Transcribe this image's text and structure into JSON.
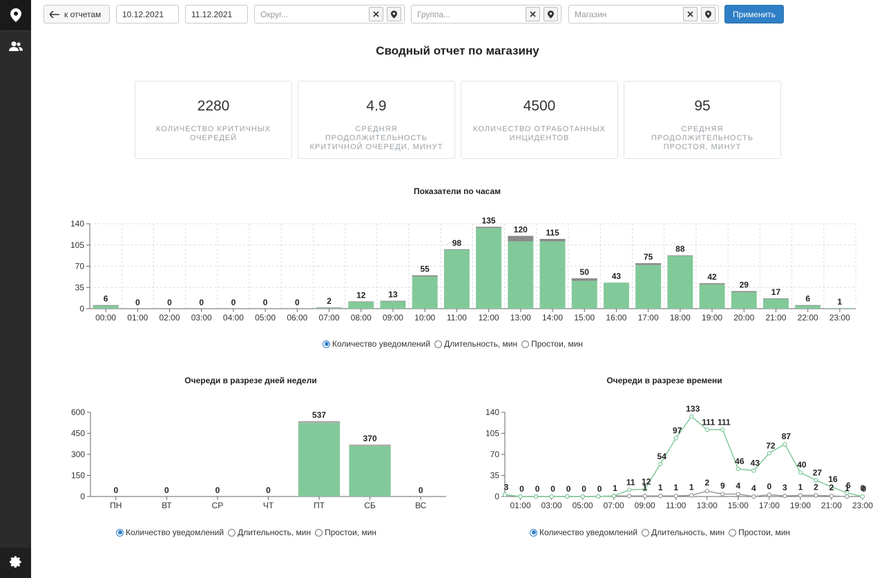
{
  "sidebar": {
    "items": [
      {
        "icon": "map-marker-icon"
      },
      {
        "icon": "users-icon"
      }
    ],
    "bottom_icon": "gear-icon"
  },
  "toolbar": {
    "back_label": "к отчетам",
    "date_from": "10.12.2021",
    "date_to": "11.12.2021",
    "okrug_placeholder": "Округ...",
    "group_placeholder": "Группа...",
    "shop_placeholder": "Магазин",
    "apply_label": "Применить"
  },
  "page": {
    "title": "Сводный отчет по магазину"
  },
  "kpis": [
    {
      "value": "2280",
      "label": "Количество критичных очередей"
    },
    {
      "value": "4.9",
      "label": "Средняя продолжительность критичной очереди, минут"
    },
    {
      "value": "4500",
      "label": "Количество отработанных инцидентов"
    },
    {
      "value": "95",
      "label": "Средняя продолжительность простоя, минут"
    }
  ],
  "radio_options": [
    "Количество уведомлений",
    "Длительность, мин",
    "Простои, мин"
  ],
  "chart_data": [
    {
      "id": "hourly",
      "type": "bar",
      "title": "Показатели по часам",
      "categories": [
        "00:00",
        "01:00",
        "02:00",
        "03:00",
        "04:00",
        "05:00",
        "06:00",
        "07:00",
        "08:00",
        "09:00",
        "10:00",
        "11:00",
        "12:00",
        "13:00",
        "14:00",
        "15:00",
        "16:00",
        "17:00",
        "18:00",
        "19:00",
        "20:00",
        "21:00",
        "22:00",
        "23:00"
      ],
      "series": [
        {
          "values": [
            5,
            0,
            0,
            0,
            0,
            0,
            0,
            1,
            11,
            12,
            53,
            97,
            133,
            111,
            111,
            46,
            43,
            72,
            87,
            40,
            27,
            16,
            5,
            1
          ],
          "color": "#82c99a"
        },
        {
          "values": [
            1,
            0,
            0,
            0,
            0,
            0,
            0,
            1,
            1,
            1,
            2,
            1,
            2,
            9,
            4,
            4,
            0,
            3,
            1,
            2,
            2,
            1,
            1,
            0
          ],
          "color": "#8a8a8a"
        }
      ],
      "totals": [
        6,
        0,
        0,
        0,
        0,
        0,
        0,
        2,
        12,
        13,
        55,
        98,
        135,
        120,
        115,
        50,
        43,
        75,
        88,
        42,
        29,
        17,
        6,
        1
      ],
      "yticks": [
        0,
        35,
        70,
        105,
        140
      ],
      "ylim": [
        0,
        140
      ],
      "grid": true
    },
    {
      "id": "weekday",
      "type": "bar",
      "title": "Очереди в разрезе дней недели",
      "categories": [
        "ПН",
        "ВТ",
        "СР",
        "ЧТ",
        "ПТ",
        "СБ",
        "ВС"
      ],
      "series": [
        {
          "values": [
            0,
            0,
            0,
            0,
            525,
            360,
            0
          ],
          "color": "#82c99a"
        },
        {
          "values": [
            0,
            0,
            0,
            0,
            12,
            10,
            0
          ],
          "color": "#a8a8a8"
        }
      ],
      "totals": [
        0,
        0,
        0,
        0,
        537,
        370,
        0
      ],
      "yticks": [
        0,
        150,
        300,
        450,
        600
      ],
      "ylim": [
        0,
        600
      ],
      "grid": false
    },
    {
      "id": "timeline",
      "type": "line",
      "title": "Очереди в разрезе времени",
      "x_ticks": [
        "01:00",
        "03:00",
        "05:00",
        "07:00",
        "09:00",
        "11:00",
        "13:00",
        "15:00",
        "17:00",
        "19:00",
        "21:00",
        "23:00"
      ],
      "x": [
        0,
        1,
        2,
        3,
        4,
        5,
        6,
        7,
        8,
        9,
        10,
        11,
        12,
        13,
        14,
        15,
        16,
        17,
        18,
        19,
        20,
        21,
        22,
        23
      ],
      "series": [
        {
          "values": [
            3,
            0,
            0,
            0,
            0,
            0,
            0,
            1,
            11,
            12,
            54,
            97,
            133,
            111,
            111,
            46,
            43,
            72,
            87,
            40,
            27,
            16,
            6,
            0
          ],
          "color": "#82c99a"
        },
        {
          "values": [
            3,
            0,
            0,
            0,
            0,
            0,
            0,
            1,
            1,
            1,
            1,
            1,
            2,
            9,
            4,
            4,
            0,
            3,
            1,
            2,
            2,
            1,
            0,
            0
          ],
          "color": "#999999"
        }
      ],
      "labels": [
        "3",
        "0",
        "0",
        "0",
        "0",
        "0",
        "0",
        "1",
        "11",
        "12",
        "54",
        "97",
        "133",
        "111",
        "111",
        "46",
        "43",
        "72",
        "87",
        "40",
        "27",
        "16",
        "6",
        "0"
      ],
      "low_labels": [
        "1",
        "1",
        "1",
        "1",
        "2",
        "9",
        "4",
        "4",
        "0",
        "3",
        "1",
        "2",
        "2",
        "1",
        "0"
      ],
      "yticks": [
        0,
        35,
        70,
        105,
        140
      ],
      "ylim": [
        0,
        140
      ],
      "grid": false
    }
  ]
}
